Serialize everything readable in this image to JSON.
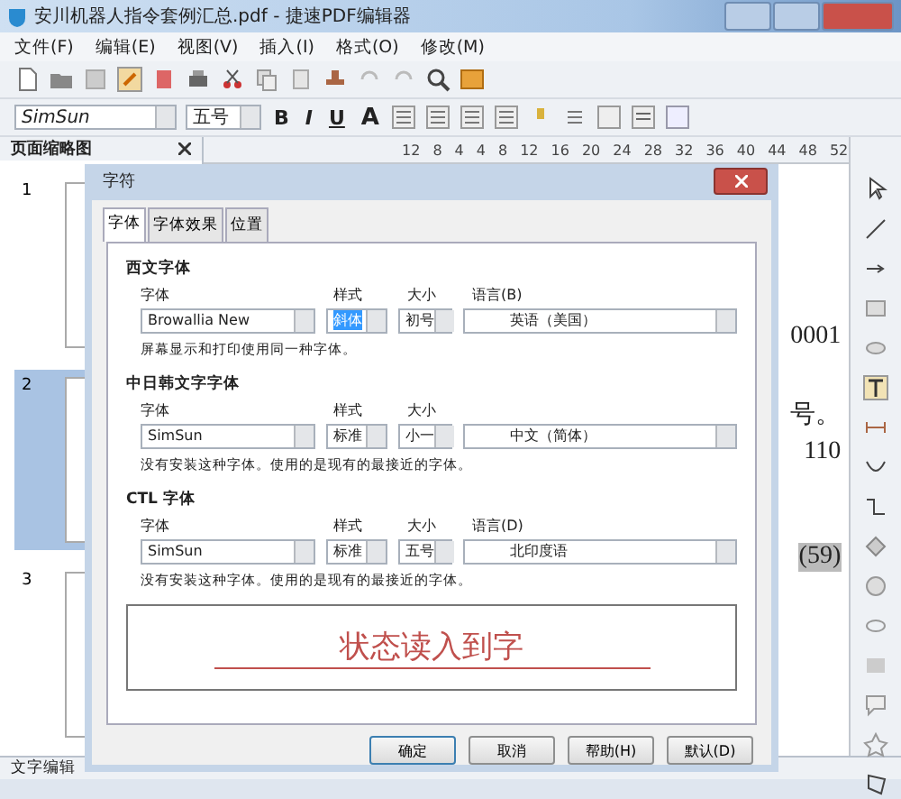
{
  "window": {
    "title": "安川机器人指令套例汇总.pdf - 捷速PDF编辑器"
  },
  "menu": [
    {
      "label": "文件(F)"
    },
    {
      "label": "编辑(E)"
    },
    {
      "label": "视图(V)"
    },
    {
      "label": "插入(I)"
    },
    {
      "label": "格式(O)"
    },
    {
      "label": "修改(M)"
    }
  ],
  "font_toolbar": {
    "font": "SimSun",
    "size": "五号",
    "format_buttons": [
      "B",
      "I",
      "U",
      "A"
    ]
  },
  "thumbnail_panel": {
    "title": "页面缩略图",
    "pages": [
      {
        "label": "1",
        "selected": false
      },
      {
        "label": "2",
        "selected": true
      },
      {
        "label": "3",
        "selected": false
      }
    ]
  },
  "ruler": {
    "ticks": [
      "12",
      "8",
      "4",
      "4",
      "8",
      "12",
      "16",
      "20",
      "24",
      "28",
      "32",
      "36",
      "40",
      "44",
      "48",
      "52"
    ]
  },
  "document": {
    "fragments": [
      {
        "text": "0001",
        "highlighted": false
      },
      {
        "text": "号。",
        "highlighted": false
      },
      {
        "text": "110",
        "highlighted": false
      },
      {
        "text": "(59)",
        "highlighted": true
      }
    ]
  },
  "dialog": {
    "title": "字符",
    "tabs": [
      {
        "label": "字体",
        "selected": true
      },
      {
        "label": "字体效果",
        "selected": false
      },
      {
        "label": "位置",
        "selected": false
      }
    ],
    "sections": [
      {
        "heading": "西文字体",
        "labels": [
          "字体",
          "样式",
          "大小",
          "语言(B)"
        ],
        "font": "Browallia New",
        "style": "斜体",
        "style_selected": true,
        "size": "初号",
        "language": "英语（美国）",
        "note": "屏幕显示和打印使用同一种字体。"
      },
      {
        "heading": "中日韩文字字体",
        "labels": [
          "字体",
          "样式",
          "大小"
        ],
        "font": "SimSun",
        "style": "标准",
        "style_selected": false,
        "size": "小一",
        "language": "中文（简体）",
        "note": "没有安装这种字体。使用的是现有的最接近的字体。"
      },
      {
        "heading": "CTL 字体",
        "labels": [
          "字体",
          "样式",
          "大小",
          "语言(D)"
        ],
        "font": "SimSun",
        "style": "标准",
        "style_selected": false,
        "size": "五号",
        "language": "北印度语",
        "note": "没有安装这种字体。使用的是现有的最接近的字体。"
      }
    ],
    "preview": "状态读入到字",
    "buttons": [
      {
        "label": "确定",
        "default": true
      },
      {
        "label": "取消",
        "default": false
      },
      {
        "label": "帮助(H)",
        "default": false
      },
      {
        "label": "默认(D)",
        "default": false
      }
    ]
  },
  "status_bar": {
    "text": "文字编辑"
  }
}
